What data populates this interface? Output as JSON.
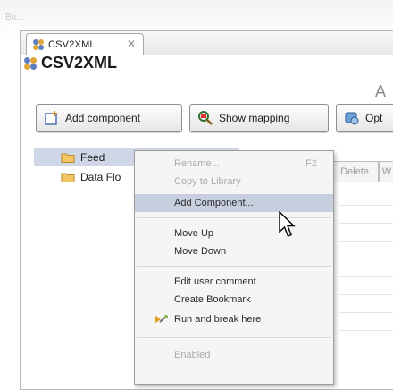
{
  "backdrop": {
    "label": "Bu..."
  },
  "editor": {
    "tab_title": "CSV2XML",
    "tab_close_glyph": "✕",
    "heading": "CSV2XML",
    "heading_right": "A"
  },
  "toolbar": {
    "add_component": "Add component",
    "show_mapping": "Show mapping",
    "options": "Opt"
  },
  "tree": {
    "items": [
      {
        "label": "Feed"
      },
      {
        "label": "Data Flo"
      }
    ]
  },
  "right_panel": {
    "delete": "Delete",
    "w": "W"
  },
  "context_menu": {
    "items": [
      {
        "label": "Rename...",
        "accel": "F2",
        "enabled": false
      },
      {
        "label": "Copy to Library",
        "enabled": false
      },
      {
        "label": "Add Component...",
        "enabled": true,
        "highlighted": true
      },
      {
        "label": "Move Up",
        "enabled": true
      },
      {
        "label": "Move Down",
        "enabled": true
      },
      {
        "label": "Edit user comment",
        "enabled": true
      },
      {
        "label": "Create Bookmark",
        "enabled": true
      },
      {
        "label": "Run and break here",
        "enabled": true
      },
      {
        "label": "Enabled",
        "enabled": false
      }
    ]
  },
  "colors": {
    "selection": "#cfd6e6",
    "menu_highlight": "#c7cfdf",
    "disabled_text": "#a9a9a9"
  }
}
